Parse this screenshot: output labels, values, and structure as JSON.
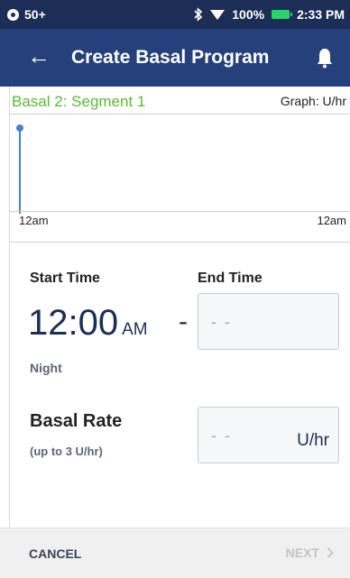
{
  "status_bar": {
    "notification_count": "50+",
    "battery_percent": "100%",
    "time": "2:33 PM"
  },
  "app_bar": {
    "title": "Create Basal Program"
  },
  "graph": {
    "segment_label": "Basal 2: Segment 1",
    "unit_label": "Graph: U/hr",
    "axis_start": "12am",
    "axis_end": "12am"
  },
  "form": {
    "start_time_label": "Start Time",
    "end_time_label": "End Time",
    "start_time_value": "12:00",
    "start_time_ampm": "AM",
    "separator": "-",
    "end_time_placeholder": "- -",
    "period_label": "Night",
    "basal_rate_label": "Basal Rate",
    "basal_rate_hint": "(up to 3 U/hr)",
    "basal_rate_placeholder": "- -",
    "basal_rate_unit": "U/hr"
  },
  "footer": {
    "cancel_label": "CANCEL",
    "next_label": "NEXT"
  },
  "colors": {
    "status_bar": "#1c2e55",
    "app_bar": "#25407a",
    "segment_label": "#5cb832",
    "graph_line": "#4a7fd0",
    "disabled": "#c4c4c4"
  }
}
